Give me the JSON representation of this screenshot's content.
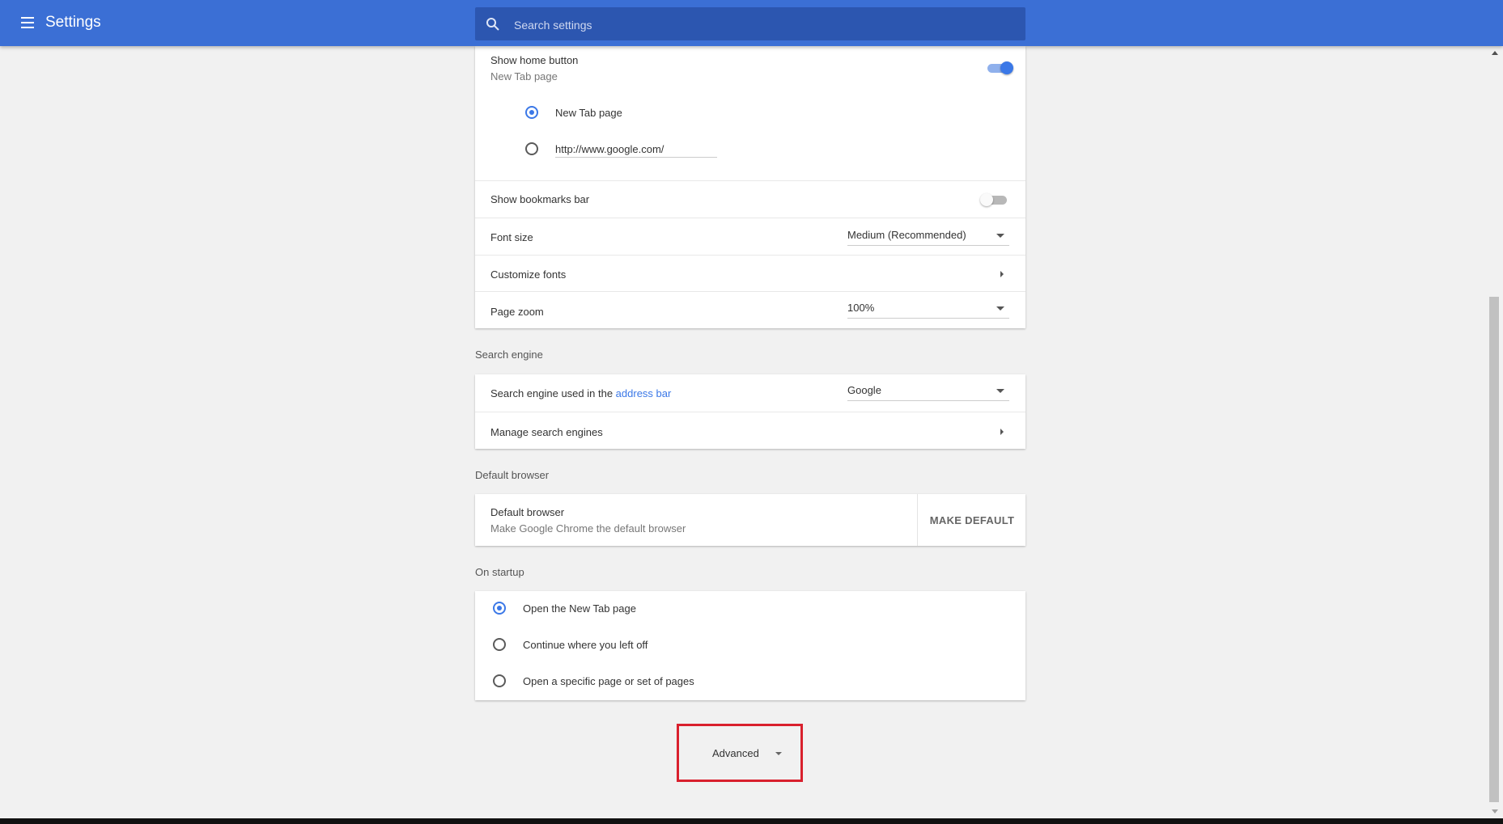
{
  "header": {
    "title": "Settings",
    "menu_icon": "hamburger-menu-icon",
    "search": {
      "placeholder": "Search settings",
      "icon": "search-icon"
    },
    "background": "#3b6fd5"
  },
  "appearance": {
    "home_button": {
      "label": "Show home button",
      "sublabel": "New Tab page",
      "enabled": true,
      "options": [
        {
          "label": "New Tab page",
          "checked": true
        },
        {
          "value": "http://www.google.com/",
          "checked": false
        }
      ]
    },
    "bookmarks_bar": {
      "label": "Show bookmarks bar",
      "enabled": false
    },
    "font_size": {
      "label": "Font size",
      "value": "Medium (Recommended)"
    },
    "customize_fonts": {
      "label": "Customize fonts"
    },
    "page_zoom": {
      "label": "Page zoom",
      "value": "100%"
    }
  },
  "search_engine": {
    "section_title": "Search engine",
    "used_label_prefix": "Search engine used in the ",
    "used_label_link": "address bar",
    "value": "Google",
    "manage_label": "Manage search engines"
  },
  "default_browser": {
    "section_title": "Default browser",
    "label": "Default browser",
    "sublabel": "Make Google Chrome the default browser",
    "button_label": "MAKE DEFAULT"
  },
  "on_startup": {
    "section_title": "On startup",
    "options": [
      {
        "label": "Open the New Tab page",
        "checked": true
      },
      {
        "label": "Continue where you left off",
        "checked": false
      },
      {
        "label": "Open a specific page or set of pages",
        "checked": false
      }
    ]
  },
  "advanced": {
    "label": "Advanced",
    "highlight_color": "#d9202d"
  },
  "colors": {
    "accent": "#3b78e7",
    "link": "#3b78e7"
  }
}
